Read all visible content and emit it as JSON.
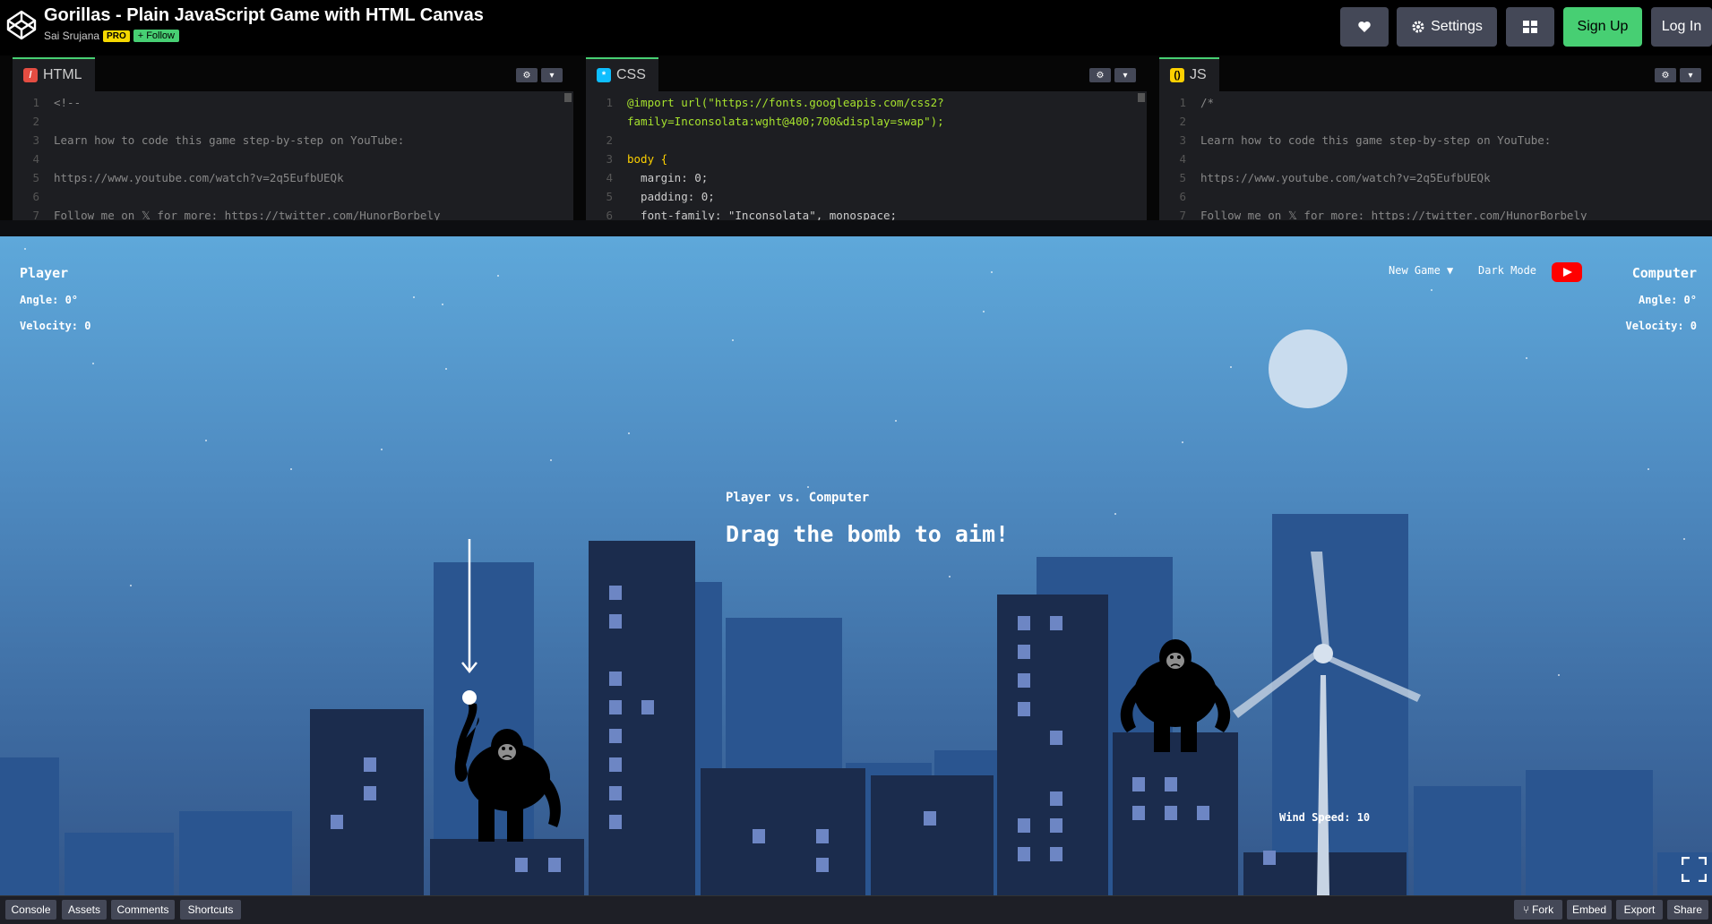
{
  "header": {
    "title": "Gorillas - Plain JavaScript Game with HTML Canvas",
    "author": "Sai Srujana",
    "pro_badge": "PRO",
    "follow_label": "+ Follow",
    "settings_label": "Settings",
    "signup_label": "Sign Up",
    "login_label": "Log In",
    "heart_icon": "heart-icon",
    "gear_icon": "gear-icon",
    "layout_icon": "layout-icon"
  },
  "editors": {
    "html": {
      "label": "HTML",
      "lines": [
        {
          "num": "1",
          "text": "<!--"
        },
        {
          "num": "2",
          "text": ""
        },
        {
          "num": "3",
          "text": "Learn how to code this game step-by-step on YouTube:"
        },
        {
          "num": "4",
          "text": ""
        },
        {
          "num": "5",
          "text": "https://www.youtube.com/watch?v=2q5EufbUEQk"
        },
        {
          "num": "6",
          "text": ""
        },
        {
          "num": "7",
          "text": "Follow me on 𝕏 for more: https://twitter.com/HunorBorbely"
        }
      ]
    },
    "css": {
      "label": "CSS",
      "lines": [
        {
          "num": "1",
          "text": "@import url(\"https://fonts.googleapis.com/css2?"
        },
        {
          "num": "",
          "text": "family=Inconsolata:wght@400;700&display=swap\");"
        },
        {
          "num": "2",
          "text": ""
        },
        {
          "num": "3",
          "text": "body {"
        },
        {
          "num": "4",
          "text": "  margin: 0;"
        },
        {
          "num": "5",
          "text": "  padding: 0;"
        },
        {
          "num": "6",
          "text": "  font-family: \"Inconsolata\", monospace;"
        }
      ]
    },
    "js": {
      "label": "JS",
      "lines": [
        {
          "num": "1",
          "text": "/*"
        },
        {
          "num": "2",
          "text": ""
        },
        {
          "num": "3",
          "text": "Learn how to code this game step-by-step on YouTube:"
        },
        {
          "num": "4",
          "text": ""
        },
        {
          "num": "5",
          "text": "https://www.youtube.com/watch?v=2q5EufbUEQk"
        },
        {
          "num": "6",
          "text": ""
        },
        {
          "num": "7",
          "text": "Follow me on 𝕏 for more: https://twitter.com/HunorBorbely"
        }
      ]
    }
  },
  "game": {
    "player": {
      "name": "Player",
      "angle": "Angle: 0°",
      "velocity": "Velocity: 0"
    },
    "computer": {
      "name": "Computer",
      "angle": "Angle: 0°",
      "velocity": "Velocity: 0"
    },
    "new_game": "New Game ▼",
    "dark_mode": "Dark Mode",
    "vs_title": "Player vs. Computer",
    "instruction": "Drag the bomb to aim!",
    "wind_speed": "Wind Speed: 10",
    "colors": {
      "sky_top": "#5ea8da",
      "sky_bottom": "#34578a",
      "building_dark": "#1b2c4d",
      "building_back": "#2a5590",
      "window": "#6d86c4",
      "moon": "#c9dcee"
    }
  },
  "footer": {
    "console": "Console",
    "assets": "Assets",
    "comments": "Comments",
    "shortcuts": "Shortcuts",
    "fork": "Fork",
    "embed": "Embed",
    "export": "Export",
    "share": "Share"
  }
}
